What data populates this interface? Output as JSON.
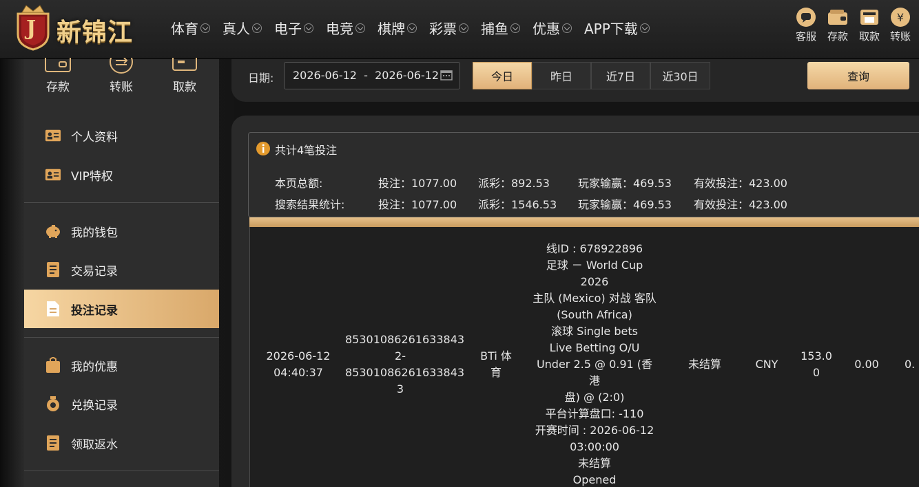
{
  "brand": {
    "name": "新锦江",
    "badge_letter": "J"
  },
  "nav": [
    {
      "label": "体育"
    },
    {
      "label": "真人"
    },
    {
      "label": "电子"
    },
    {
      "label": "电竞"
    },
    {
      "label": "棋牌"
    },
    {
      "label": "彩票"
    },
    {
      "label": "捕鱼"
    },
    {
      "label": "优惠"
    },
    {
      "label": "APP下载"
    }
  ],
  "quick": [
    {
      "label": "客服",
      "icon": "chat-icon"
    },
    {
      "label": "存款",
      "icon": "wallet-icon"
    },
    {
      "label": "取款",
      "icon": "atm-icon"
    },
    {
      "label": "转账",
      "icon": "yuan-coin-icon"
    }
  ],
  "sidebar": {
    "top": [
      {
        "label": "存款",
        "icon": "wallet-icon"
      },
      {
        "label": "转账",
        "icon": "transfer-icon"
      },
      {
        "label": "取款",
        "icon": "card-icon"
      }
    ],
    "items": [
      {
        "label": "个人资料",
        "icon": "id-card-icon"
      },
      {
        "label": "VIP特权",
        "icon": "vip-card-icon"
      },
      {
        "label": "我的钱包",
        "icon": "piggy-bank-icon"
      },
      {
        "label": "交易记录",
        "icon": "document-icon"
      },
      {
        "label": "投注记录",
        "icon": "bet-record-icon",
        "active": true
      },
      {
        "label": "我的优惠",
        "icon": "gift-bag-icon"
      },
      {
        "label": "兑换记录",
        "icon": "exchange-icon"
      },
      {
        "label": "领取返水",
        "icon": "rebate-icon"
      }
    ]
  },
  "filter": {
    "date_label": "日期:",
    "date_value": "2026-06-12  -  2026-06-12",
    "ranges": [
      "今日",
      "昨日",
      "近7日",
      "近30日"
    ],
    "active_range": "今日",
    "search_label": "查询"
  },
  "summary": {
    "title": "共计4笔投注",
    "rows": [
      {
        "label": "本页总额:",
        "bet": "投注：1077.00",
        "payout": "派彩：892.53",
        "winloss": "玩家输赢：469.53",
        "valid": "有效投注：423.00"
      },
      {
        "label": "搜索结果统计:",
        "bet": "投注：1077.00",
        "payout": "派彩：1546.53",
        "winloss": "玩家输赢：469.53",
        "valid": "有效投注：423.00"
      }
    ]
  },
  "record": {
    "time_line1": "2026-06-12",
    "time_line2": "04:40:37",
    "order_lines": [
      "85301086261633843",
      "2-",
      "85301086261633843",
      "3"
    ],
    "platform_lines": [
      "BTi 体",
      "育"
    ],
    "detail_lines": [
      "线ID : 678922896",
      "足球 － World Cup",
      "2026",
      "主队 (Mexico) 对战 客队",
      "(South Africa)",
      "滚球 Single bets",
      "Live Betting O/U",
      "Under 2.5 @ 0.91 (香港",
      "盘) @ (2:0)",
      "平台计算盘口: -110",
      "开赛时间 : 2026-06-12",
      "03:00:00",
      "未结算",
      "Opened"
    ],
    "status": "未结算",
    "currency": "CNY",
    "amount_lines": [
      "153.0",
      "0"
    ],
    "payout": "0.00",
    "last_partial": "0."
  },
  "colors": {
    "accent": "#e1b27a",
    "accent_light": "#f4d8a7",
    "bg": "#2a2a2a"
  }
}
